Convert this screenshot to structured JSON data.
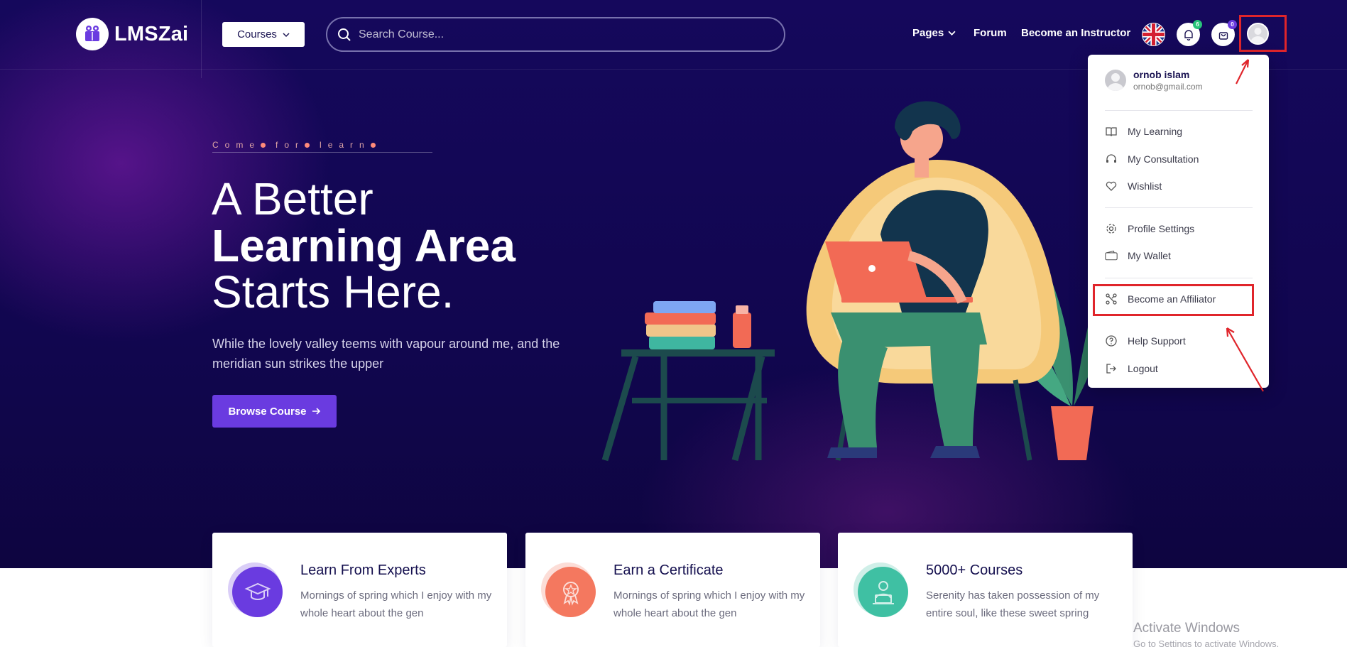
{
  "header": {
    "logo_text": "LMSZai",
    "courses_label": "Courses",
    "search_placeholder": "Search Course...",
    "nav": {
      "pages": "Pages",
      "forum": "Forum",
      "become_instructor": "Become an Instructor"
    },
    "notification_count": "6",
    "cart_count": "0",
    "colors": {
      "notification_badge": "#29c47a",
      "cart_badge": "#6a3be0"
    }
  },
  "hero": {
    "tagline": [
      "Come",
      "for",
      "learn"
    ],
    "title_line1": "A Better",
    "title_line2": "Learning Area",
    "title_line3": "Starts Here.",
    "description": "While the lovely valley teems with vapour around me, and the meridian sun strikes the upper",
    "cta_label": "Browse Course"
  },
  "dropdown": {
    "user_name": "ornob islam",
    "user_email": "ornob@gmail.com",
    "items": [
      {
        "label": "My Learning",
        "icon": "book-icon"
      },
      {
        "label": "My Consultation",
        "icon": "headset-icon"
      },
      {
        "label": "Wishlist",
        "icon": "heart-icon"
      },
      {
        "label": "Profile Settings",
        "icon": "gear-icon"
      },
      {
        "label": "My Wallet",
        "icon": "wallet-icon"
      },
      {
        "label": "Become an Affiliator",
        "icon": "affiliate-icon"
      },
      {
        "label": "Help Support",
        "icon": "question-icon"
      },
      {
        "label": "Logout",
        "icon": "logout-icon"
      }
    ]
  },
  "features": [
    {
      "title": "Learn From Experts",
      "description": "Mornings of spring which I enjoy with my whole heart about the gen",
      "color": "#6a3be0",
      "icon": "graduation-cap-icon"
    },
    {
      "title": "Earn a Certificate",
      "description": "Mornings of spring which I enjoy with my whole heart about the gen",
      "color": "#f4785f",
      "icon": "certificate-icon"
    },
    {
      "title": "5000+ Courses",
      "description": "Serenity has taken possession of my entire soul, like these sweet spring",
      "color": "#3fc1a3",
      "icon": "laptop-user-icon"
    }
  ],
  "watermark": {
    "title": "Activate Windows",
    "subtitle": "Go to Settings to activate Windows."
  }
}
